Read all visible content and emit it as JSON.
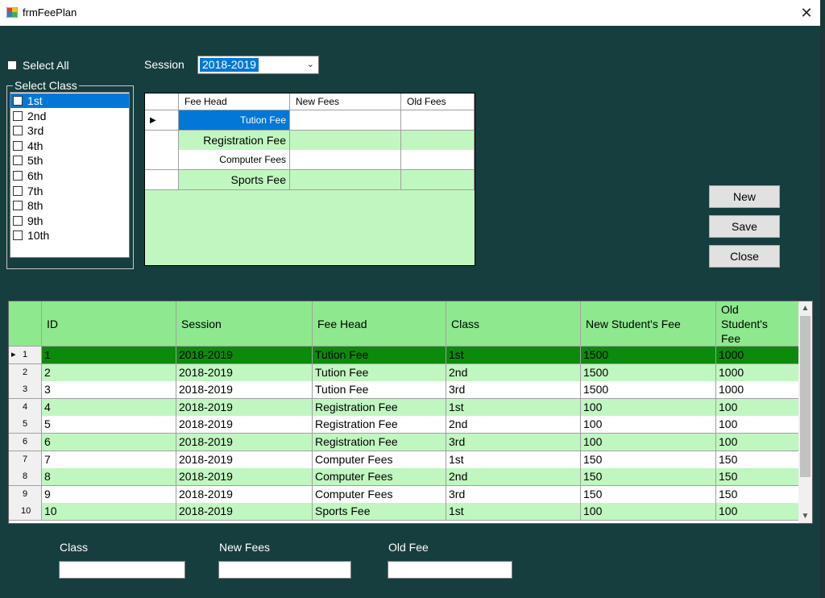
{
  "window": {
    "title": "frmFeePlan"
  },
  "select_all": {
    "label": "Select All",
    "checked": false
  },
  "session": {
    "label": "Session",
    "value": "2018-2019"
  },
  "class_group": {
    "title": "Select Class",
    "items": [
      "1st",
      "2nd",
      "3rd",
      "4th",
      "5th",
      "6th",
      "7th",
      "8th",
      "9th",
      "10th"
    ],
    "selected_index": 0
  },
  "fee_grid": {
    "headers": [
      "Fee Head",
      "New Fees",
      "Old Fees"
    ],
    "rows": [
      {
        "fee_head": "Tution Fee",
        "new_fees": "",
        "old_fees": ""
      },
      {
        "fee_head": "Registration Fee",
        "new_fees": "",
        "old_fees": ""
      },
      {
        "fee_head": "Computer Fees",
        "new_fees": "",
        "old_fees": ""
      },
      {
        "fee_head": "Sports Fee",
        "new_fees": "",
        "old_fees": ""
      }
    ]
  },
  "buttons": {
    "new": "New",
    "save": "Save",
    "close": "Close"
  },
  "main_grid": {
    "headers": [
      "ID",
      "Session",
      "Fee Head",
      "Class",
      "New Student's Fee",
      "Old Student's Fee"
    ],
    "rows": [
      {
        "n": "1",
        "id": "1",
        "session": "2018-2019",
        "fee_head": "Tution Fee",
        "class": "1st",
        "new_fee": "1500",
        "old_fee": "1000"
      },
      {
        "n": "2",
        "id": "2",
        "session": "2018-2019",
        "fee_head": "Tution Fee",
        "class": "2nd",
        "new_fee": "1500",
        "old_fee": "1000"
      },
      {
        "n": "3",
        "id": "3",
        "session": "2018-2019",
        "fee_head": "Tution Fee",
        "class": "3rd",
        "new_fee": "1500",
        "old_fee": "1000"
      },
      {
        "n": "4",
        "id": "4",
        "session": "2018-2019",
        "fee_head": "Registration Fee",
        "class": "1st",
        "new_fee": "100",
        "old_fee": "100"
      },
      {
        "n": "5",
        "id": "5",
        "session": "2018-2019",
        "fee_head": "Registration Fee",
        "class": "2nd",
        "new_fee": "100",
        "old_fee": "100"
      },
      {
        "n": "6",
        "id": "6",
        "session": "2018-2019",
        "fee_head": "Registration Fee",
        "class": "3rd",
        "new_fee": "100",
        "old_fee": "100"
      },
      {
        "n": "7",
        "id": "7",
        "session": "2018-2019",
        "fee_head": "Computer Fees",
        "class": "1st",
        "new_fee": "150",
        "old_fee": "150"
      },
      {
        "n": "8",
        "id": "8",
        "session": "2018-2019",
        "fee_head": "Computer Fees",
        "class": "2nd",
        "new_fee": "150",
        "old_fee": "150"
      },
      {
        "n": "9",
        "id": "9",
        "session": "2018-2019",
        "fee_head": "Computer Fees",
        "class": "3rd",
        "new_fee": "150",
        "old_fee": "150"
      },
      {
        "n": "10",
        "id": "10",
        "session": "2018-2019",
        "fee_head": "Sports Fee",
        "class": "1st",
        "new_fee": "100",
        "old_fee": "100"
      }
    ]
  },
  "fields": {
    "class_label": "Class",
    "new_fees_label": "New Fees",
    "old_fee_label": "Old Fee",
    "class_value": "",
    "new_fees_value": "",
    "old_fee_value": ""
  },
  "colors": {
    "background": "#173e3e",
    "grid_header": "#8ee98e",
    "grid_alt_row": "#c0f7c0",
    "grid_selected_row": "#0b8a0b",
    "selection_blue": "#0078d7"
  }
}
